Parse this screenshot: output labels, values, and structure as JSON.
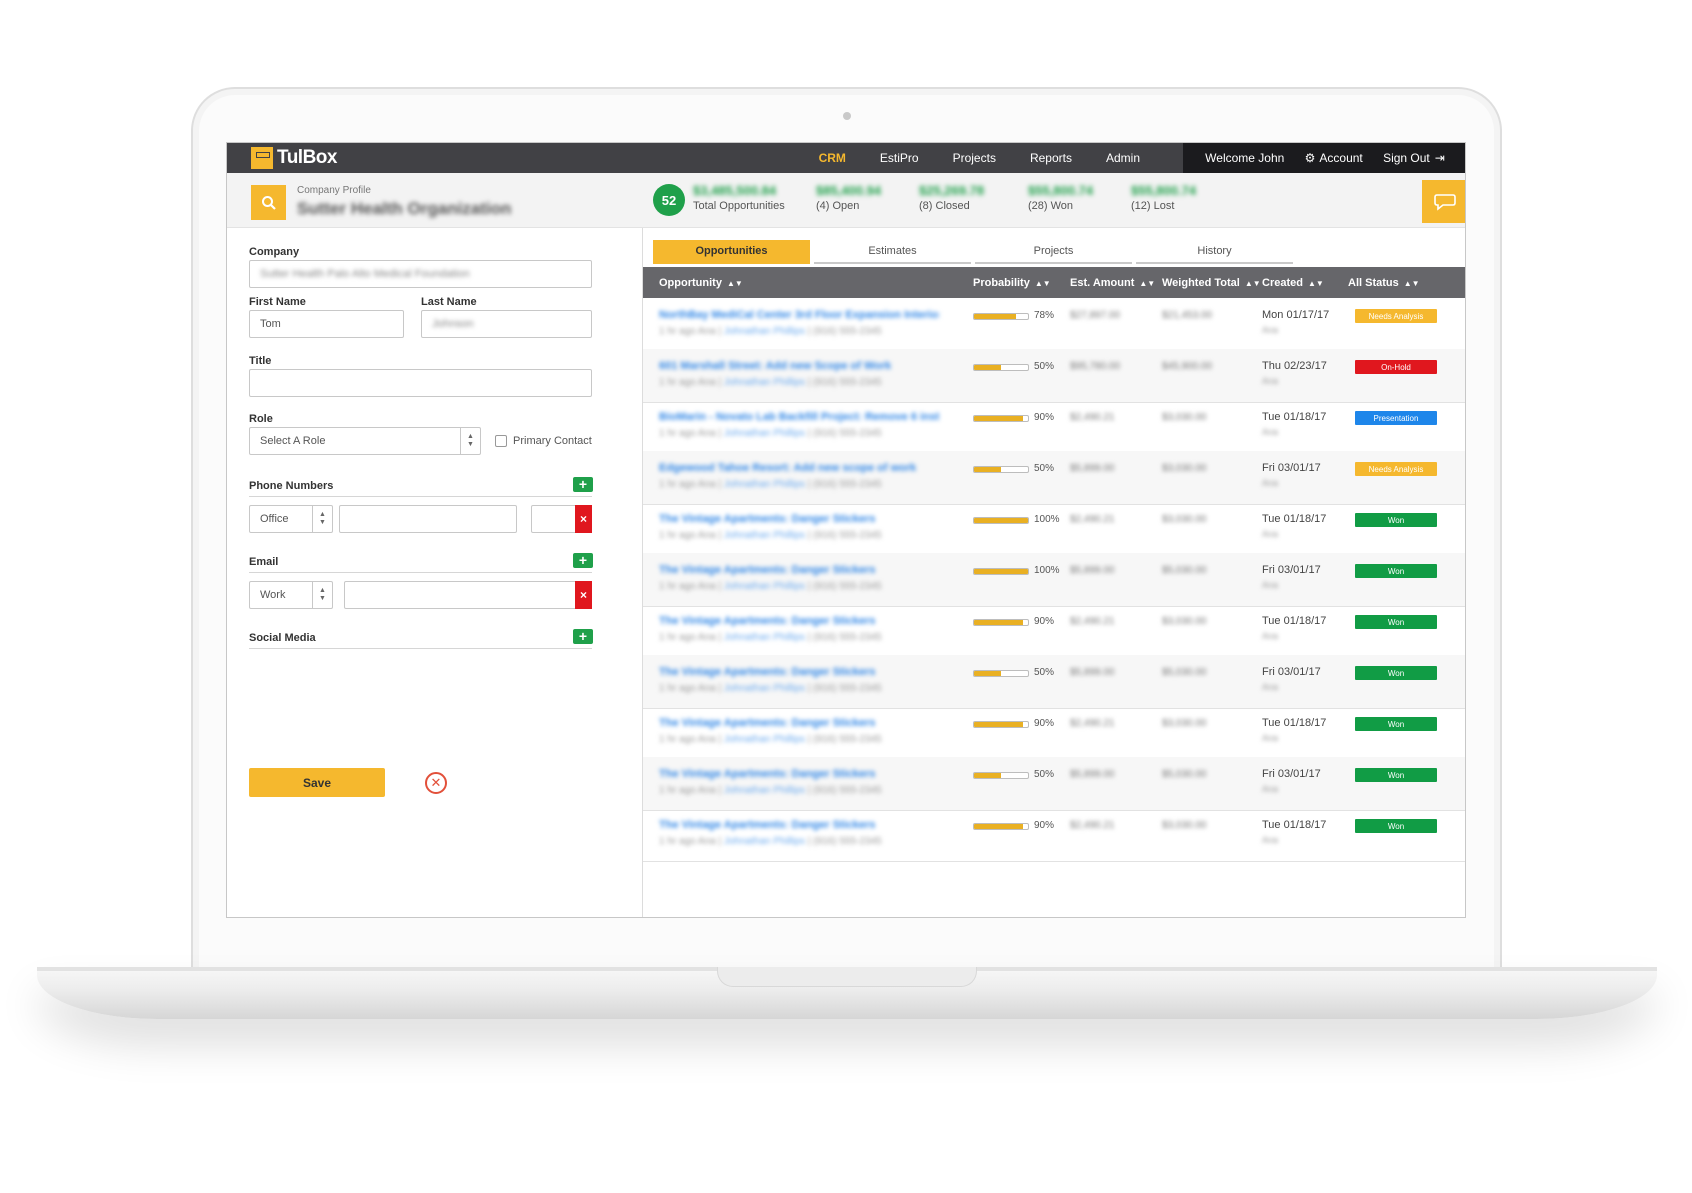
{
  "app": {
    "logo_text": "TulBox"
  },
  "nav": {
    "items": [
      {
        "label": "CRM",
        "active": true
      },
      {
        "label": "EstiPro",
        "active": false
      },
      {
        "label": "Projects",
        "active": false
      },
      {
        "label": "Reports",
        "active": false
      },
      {
        "label": "Admin",
        "active": false
      }
    ],
    "welcome": "Welcome John",
    "account": "Account",
    "sign_out": "Sign Out"
  },
  "profile": {
    "label": "Company Profile",
    "name": "Sutter Health Organization"
  },
  "summary": {
    "total_count": "52",
    "stats": [
      {
        "amount": "$3,485,500.84",
        "label": "Total Opportunities"
      },
      {
        "amount": "$85,400.94",
        "label": "(4) Open"
      },
      {
        "amount": "$25,269.78",
        "label": "(8) Closed"
      },
      {
        "amount": "$55,800.74",
        "label": "(28) Won"
      },
      {
        "amount": "$55,800.74",
        "label": "(12) Lost"
      }
    ]
  },
  "form": {
    "company_label": "Company",
    "company_value": "Sutter Health Palo Alto Medical Foundation",
    "first_name_label": "First Name",
    "first_name_value": "Tom",
    "last_name_label": "Last Name",
    "last_name_value": "Johnson",
    "title_label": "Title",
    "title_value": "",
    "role_label": "Role",
    "role_value": "Select A Role",
    "primary_contact_label": "Primary Contact",
    "phone_label": "Phone Numbers",
    "phone_type": "Office",
    "email_label": "Email",
    "email_type": "Work",
    "social_label": "Social Media",
    "save_label": "Save",
    "plus_symbol": "+",
    "x_symbol": "×",
    "cancel_symbol": "✕"
  },
  "tabs": [
    {
      "label": "Opportunities",
      "active": true
    },
    {
      "label": "Estimates",
      "active": false
    },
    {
      "label": "Projects",
      "active": false
    },
    {
      "label": "History",
      "active": false
    }
  ],
  "table": {
    "headers": {
      "opportunity": "Opportunity",
      "probability": "Probability",
      "est_amount": "Est. Amount",
      "weighted_total": "Weighted Total",
      "created": "Created",
      "status": "All Status"
    },
    "rows": [
      {
        "title": "NorthBay MediCal Center 3rd Floor Expansion Interior...",
        "sub_a": "1 hr ago Ana",
        "sub_b": "Johnathan Phillips",
        "sub_c": "(916) 555-2345",
        "probability": 78,
        "prob_label": "78%",
        "est": "$27,897.00",
        "weighted": "$21,453.00",
        "created": "Mon 01/17/17",
        "created_by": "Ana",
        "status": "Needs Analysis",
        "status_color": "#f5b82e"
      },
      {
        "title": "601 Marshall Street: Add new Scope of Work",
        "sub_a": "1 hr ago Ana",
        "sub_b": "Johnathan Phillips",
        "sub_c": "(916) 555-2345",
        "probability": 50,
        "prob_label": "50%",
        "est": "$95,780.00",
        "weighted": "$45,900.00",
        "created": "Thu 02/23/17",
        "created_by": "Ana",
        "status": "On-Hold",
        "status_color": "#e0171e"
      },
      {
        "title": "BioMarin - Novato Lab Backfill Project: Remove 6 insta...",
        "sub_a": "1 hr ago Ana",
        "sub_b": "Johnathan Phillips",
        "sub_c": "(916) 555-2345",
        "probability": 90,
        "prob_label": "90%",
        "est": "$2,490.21",
        "weighted": "$3,030.00",
        "created": "Tue 01/18/17",
        "created_by": "Ana",
        "status": "Presentation",
        "status_color": "#1e86ea"
      },
      {
        "title": "Edgewood Tahoe Resort: Add new scope of work",
        "sub_a": "1 hr ago Ana",
        "sub_b": "Johnathan Phillips",
        "sub_c": "(916) 555-2345",
        "probability": 50,
        "prob_label": "50%",
        "est": "$5,899.00",
        "weighted": "$3,030.00",
        "created": "Fri 03/01/17",
        "created_by": "Ana",
        "status": "Needs Analysis",
        "status_color": "#f5b82e"
      },
      {
        "title": "The Vintage Apartments: Danger Stickers",
        "sub_a": "1 hr ago Ana",
        "sub_b": "Johnathan Phillips",
        "sub_c": "(916) 555-2345",
        "probability": 100,
        "prob_label": "100%",
        "est": "$2,490.21",
        "weighted": "$3,030.00",
        "created": "Tue 01/18/17",
        "created_by": "Ana",
        "status": "Won",
        "status_color": "#119c45"
      },
      {
        "title": "The Vintage Apartments: Danger Stickers",
        "sub_a": "1 hr ago Ana",
        "sub_b": "Johnathan Phillips",
        "sub_c": "(916) 555-2345",
        "probability": 100,
        "prob_label": "100%",
        "est": "$5,899.00",
        "weighted": "$5,030.00",
        "created": "Fri 03/01/17",
        "created_by": "Ana",
        "status": "Won",
        "status_color": "#119c45"
      },
      {
        "title": "The Vintage Apartments: Danger Stickers",
        "sub_a": "1 hr ago Ana",
        "sub_b": "Johnathan Phillips",
        "sub_c": "(916) 555-2345",
        "probability": 90,
        "prob_label": "90%",
        "est": "$2,490.21",
        "weighted": "$3,030.00",
        "created": "Tue 01/18/17",
        "created_by": "Ana",
        "status": "Won",
        "status_color": "#119c45"
      },
      {
        "title": "The Vintage Apartments: Danger Stickers",
        "sub_a": "1 hr ago Ana",
        "sub_b": "Johnathan Phillips",
        "sub_c": "(916) 555-2345",
        "probability": 50,
        "prob_label": "50%",
        "est": "$5,899.00",
        "weighted": "$5,030.00",
        "created": "Fri 03/01/17",
        "created_by": "Ana",
        "status": "Won",
        "status_color": "#119c45"
      },
      {
        "title": "The Vintage Apartments: Danger Stickers",
        "sub_a": "1 hr ago Ana",
        "sub_b": "Johnathan Phillips",
        "sub_c": "(916) 555-2345",
        "probability": 90,
        "prob_label": "90%",
        "est": "$2,490.21",
        "weighted": "$3,030.00",
        "created": "Tue 01/18/17",
        "created_by": "Ana",
        "status": "Won",
        "status_color": "#119c45"
      },
      {
        "title": "The Vintage Apartments: Danger Stickers",
        "sub_a": "1 hr ago Ana",
        "sub_b": "Johnathan Phillips",
        "sub_c": "(916) 555-2345",
        "probability": 50,
        "prob_label": "50%",
        "est": "$5,899.00",
        "weighted": "$5,030.00",
        "created": "Fri 03/01/17",
        "created_by": "Ana",
        "status": "Won",
        "status_color": "#119c45"
      },
      {
        "title": "The Vintage Apartments: Danger Stickers",
        "sub_a": "1 hr ago Ana",
        "sub_b": "Johnathan Phillips",
        "sub_c": "(916) 555-2345",
        "probability": 90,
        "prob_label": "90%",
        "est": "$2,490.21",
        "weighted": "$3,030.00",
        "created": "Tue 01/18/17",
        "created_by": "Ana",
        "status": "Won",
        "status_color": "#119c45"
      }
    ]
  },
  "colors": {
    "accent": "#f5b82e",
    "green": "#1fa04a",
    "red": "#e0171e",
    "blue": "#1e86ea",
    "topbar": "#414145"
  },
  "icons": {
    "search": "search-icon",
    "chat": "chat-icon",
    "gear": "gear-icon",
    "sign_out": "sign-out-icon"
  }
}
